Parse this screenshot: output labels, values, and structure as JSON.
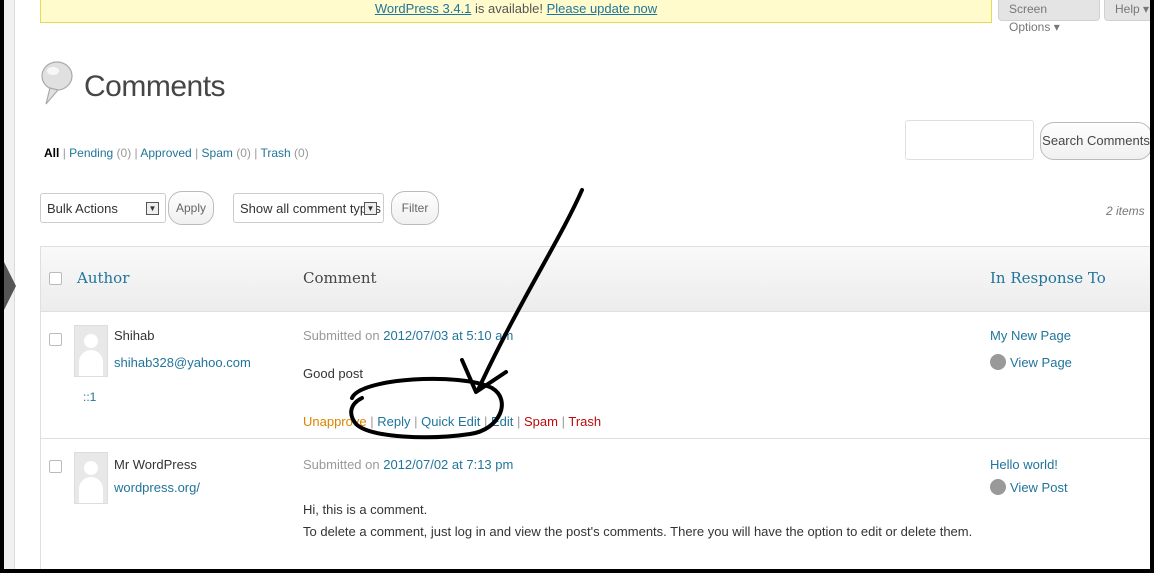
{
  "update_nag": {
    "version_text": "WordPress 3.4.1",
    "middle_text": " is available! ",
    "link_text": "Please update now"
  },
  "screen_options_label": "Screen Options ▾",
  "help_label": "Help ▾",
  "page_title": "Comments",
  "filters": [
    {
      "label": "All",
      "count": ""
    },
    {
      "label": "Pending",
      "count": "(0)"
    },
    {
      "label": "Approved",
      "count": ""
    },
    {
      "label": "Spam",
      "count": "(0)"
    },
    {
      "label": "Trash",
      "count": "(0)"
    }
  ],
  "search": {
    "button_label": "Search Comments",
    "placeholder": ""
  },
  "bulk_actions": {
    "selected": "Bulk Actions",
    "apply_label": "Apply"
  },
  "type_filter": {
    "selected": "Show all comment types",
    "filter_label": "Filter"
  },
  "items_count": "2 items",
  "columns": {
    "author": "Author",
    "comment": "Comment",
    "in_response_to": "In Response To"
  },
  "comments": [
    {
      "author_name": "Shihab",
      "author_link": "shihab328@yahoo.com",
      "author_ip": "::1",
      "submitted_prefix": "Submitted on ",
      "submitted_date": "2012/07/03 at 5:10 am",
      "text_lines": [
        "Good post"
      ],
      "actions": {
        "unapprove": "Unapprove",
        "reply": "Reply",
        "quick_edit": "Quick Edit",
        "edit": "Edit",
        "spam": "Spam",
        "trash": "Trash"
      },
      "response_title": "My New Page",
      "response_view": "View Page"
    },
    {
      "author_name": "Mr WordPress",
      "author_link": "wordpress.org/",
      "submitted_prefix": "Submitted on ",
      "submitted_date": "2012/07/02 at 7:13 pm",
      "text_lines": [
        "Hi, this is a comment.",
        "To delete a comment, just log in and view the post's comments. There you will have the option to edit or delete them."
      ],
      "response_title": "Hello world!",
      "response_view": "View Post"
    }
  ],
  "colors": {
    "link": "#21759b",
    "unapprove": "#d98500",
    "trash": "#bc0b0b",
    "nag_bg": "#fffbcc"
  }
}
